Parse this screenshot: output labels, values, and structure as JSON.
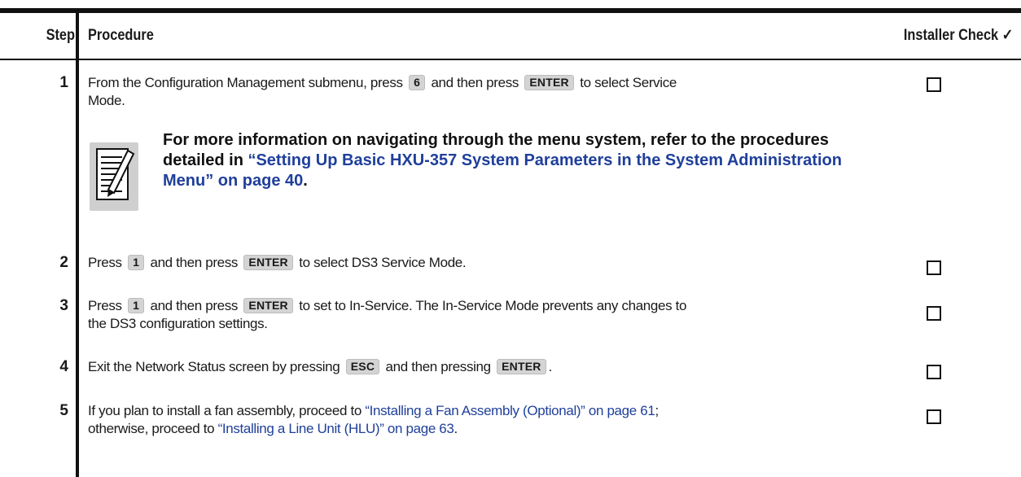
{
  "header": {
    "step": "Step",
    "procedure": "Procedure",
    "check": "Installer Check ✓"
  },
  "steps": [
    {
      "num": "1",
      "t1": "From the Configuration Management submenu, press",
      "k1": "6",
      "t2": "and then press",
      "k2": "ENTER",
      "t3": "to select Service",
      "t4": "Mode."
    },
    {
      "num": "2",
      "t1": "Press",
      "k1": "1",
      "t2": "and then press",
      "k2": "ENTER",
      "t3": "to select DS3 Service Mode."
    },
    {
      "num": "3",
      "t1": "Press",
      "k1": "1",
      "t2": "and then press",
      "k2": "ENTER",
      "t3": "to set to In-Service. The In-Service Mode prevents any changes to",
      "t4": "the DS3 configuration settings."
    },
    {
      "num": "4",
      "t1": "Exit the Network Status screen by pressing",
      "k1": "ESC",
      "t2": "and then pressing",
      "k2": "ENTER",
      "t3": "."
    },
    {
      "num": "5",
      "t1": "If you plan to install a fan assembly, proceed to",
      "l1": "“Installing a Fan Assembly (Optional)” on page 61",
      "t2": ";",
      "t3": "otherwise, proceed to",
      "l2": "“Installing a Line Unit (HLU)” on page 63",
      "t4": "."
    }
  ],
  "note": {
    "icon": "note-pencil-icon",
    "t1": "For more information on navigating through the menu system, refer to the procedures",
    "t2": "detailed in",
    "link": "“Setting Up Basic HXU-357 System Parameters in the System Administration",
    "t3": "Menu” on page 40",
    "t4": "."
  },
  "colors": {
    "link": "#1f3f9a",
    "key_bg": "#d4d4d4",
    "rule": "#111111"
  }
}
